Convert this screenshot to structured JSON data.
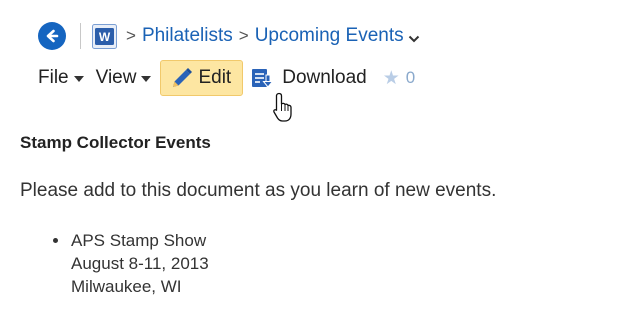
{
  "breadcrumb": {
    "back_icon": "back-arrow-icon",
    "doc_icon": "word-document-icon",
    "doc_icon_letter": "W",
    "separator": ">",
    "items": [
      {
        "label": "Philatelists"
      },
      {
        "label": "Upcoming Events"
      }
    ]
  },
  "toolbar": {
    "file_label": "File",
    "view_label": "View",
    "edit_label": "Edit",
    "download_label": "Download",
    "rating_count": "0"
  },
  "document": {
    "title": "Stamp Collector Events",
    "intro": "Please add to this document as you learn of new events.",
    "events": [
      {
        "name": "APS Stamp Show",
        "dates": "August 8-11, 2013",
        "location": "Milwaukee, WI"
      }
    ]
  },
  "colors": {
    "link": "#1a62b5",
    "back_button": "#1565c0",
    "edit_highlight": "#fde6a2",
    "doc_icon": "#2b5eab"
  }
}
